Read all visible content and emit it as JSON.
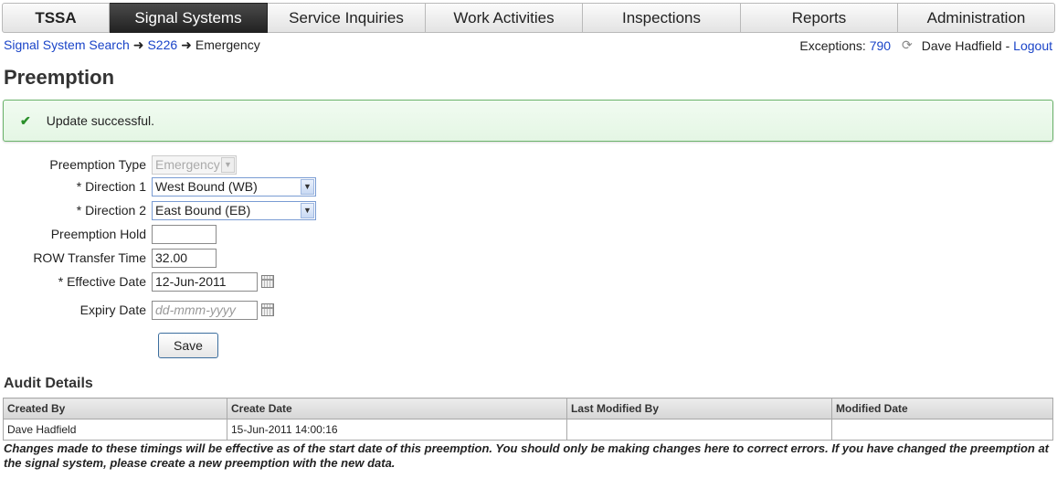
{
  "nav": {
    "items": [
      {
        "label": "TSSA"
      },
      {
        "label": "Signal Systems"
      },
      {
        "label": "Service Inquiries"
      },
      {
        "label": "Work Activities"
      },
      {
        "label": "Inspections"
      },
      {
        "label": "Reports"
      },
      {
        "label": "Administration"
      }
    ],
    "active": "Signal Systems"
  },
  "breadcrumb": {
    "items": [
      "Signal System Search",
      "S226",
      "Emergency"
    ],
    "separator": "➜"
  },
  "userbar": {
    "exceptions_label": "Exceptions:",
    "exceptions_count": "790",
    "user_name": "Dave Hadfield",
    "dash": "-",
    "logout_label": "Logout"
  },
  "page": {
    "title": "Preemption"
  },
  "banner": {
    "message": "Update successful."
  },
  "form": {
    "preemption_type": {
      "label": "Preemption Type",
      "value": "Emergency"
    },
    "direction1": {
      "label": "* Direction 1",
      "value": "West Bound (WB)"
    },
    "direction2": {
      "label": "* Direction 2",
      "value": "East Bound (EB)"
    },
    "preemption_hold": {
      "label": "Preemption Hold",
      "value": ""
    },
    "row_transfer_time": {
      "label": "ROW Transfer Time",
      "value": "32.00"
    },
    "effective_date": {
      "label": "* Effective Date",
      "value": "12-Jun-2011"
    },
    "expiry_date": {
      "label": "Expiry Date",
      "value": "",
      "placeholder": "dd-mmm-yyyy"
    },
    "save_label": "Save"
  },
  "audit": {
    "title": "Audit Details",
    "columns": [
      "Created By",
      "Create Date",
      "Last Modified By",
      "Modified Date"
    ],
    "rows": [
      [
        "Dave Hadfield",
        "15-Jun-2011 14:00:16",
        "",
        ""
      ]
    ],
    "note": "Changes made to these timings will be effective as of the start date of this preemption. You should only be making changes here to correct errors. If you have changed the preemption at the signal system, please create a new preemption with the new data."
  },
  "colors": {
    "link": "#1a44c8",
    "nav_active_bg": "#222222",
    "success_border": "#6bb36b",
    "success_bg": "#e4f6e4"
  }
}
